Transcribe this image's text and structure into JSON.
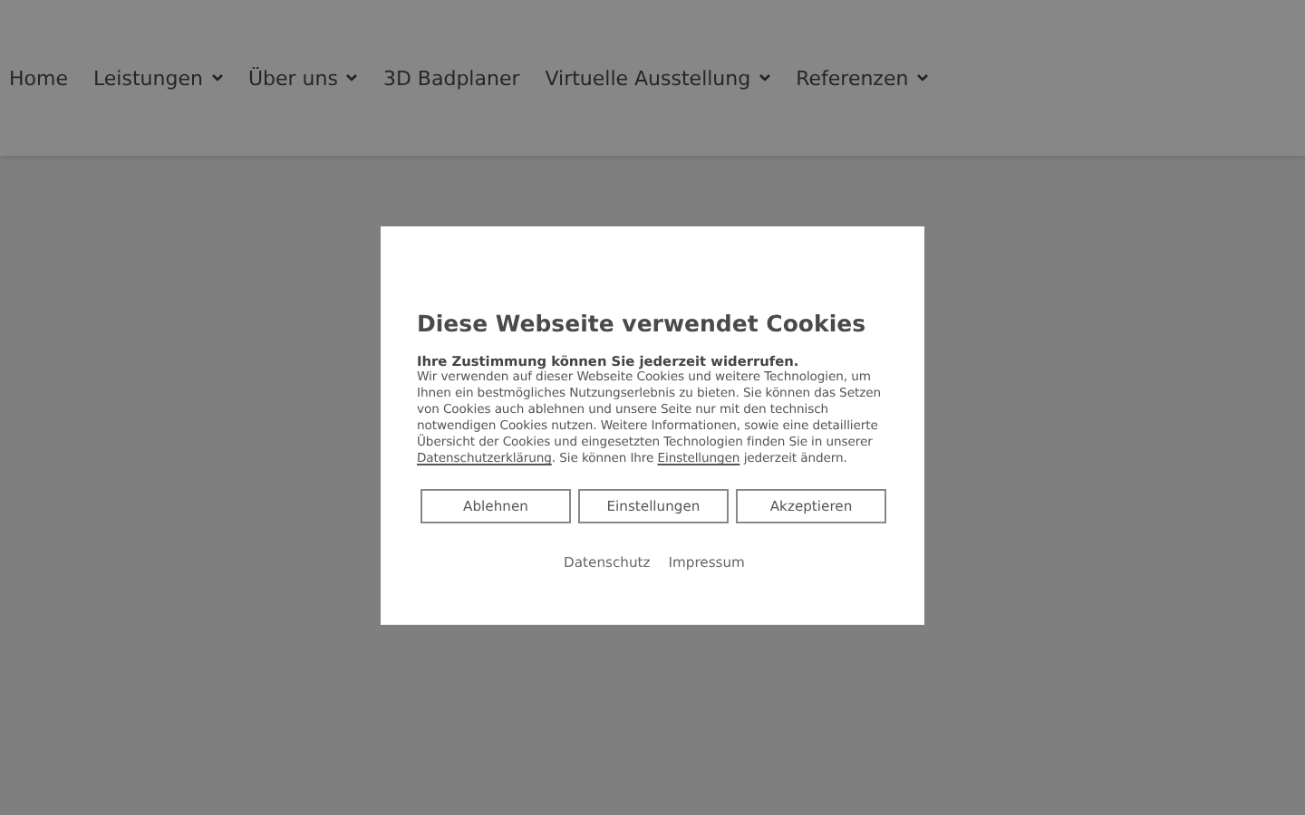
{
  "nav": [
    {
      "label": "Home",
      "has_dropdown": false
    },
    {
      "label": "Leistungen",
      "has_dropdown": true
    },
    {
      "label": "Über uns",
      "has_dropdown": true
    },
    {
      "label": "3D Badplaner",
      "has_dropdown": false
    },
    {
      "label": "Virtuelle Ausstellung",
      "has_dropdown": true
    },
    {
      "label": "Referenzen",
      "has_dropdown": true
    }
  ],
  "dialog": {
    "title": "Diese Webseite verwendet Cookies",
    "lead": "Ihre Zustimmung können Sie jederzeit widerrufen.",
    "body": [
      {
        "kind": "text",
        "text": "Wir verwenden auf dieser Webseite Cookies und weitere Technologien, um Ihnen ein bestmögliches Nutzungserlebnis zu bieten. Sie können das Setzen von Cookies auch ablehnen und unsere Seite nur mit den technisch notwendigen Cookies nutzen. Weitere Informationen, sowie eine detaillierte Übersicht der Cookies und eingesetzten Technologien finden Sie in unserer "
      },
      {
        "kind": "link",
        "text": "Datenschutzerklärung"
      },
      {
        "kind": "text",
        "text": ". Sie können Ihre "
      },
      {
        "kind": "link",
        "text": "Einstellungen"
      },
      {
        "kind": "text",
        "text": " jederzeit ändern."
      }
    ],
    "buttons": [
      "Ablehnen",
      "Einstellungen",
      "Akzeptieren"
    ],
    "footer_links": [
      "Datenschutz",
      "Impressum"
    ]
  }
}
